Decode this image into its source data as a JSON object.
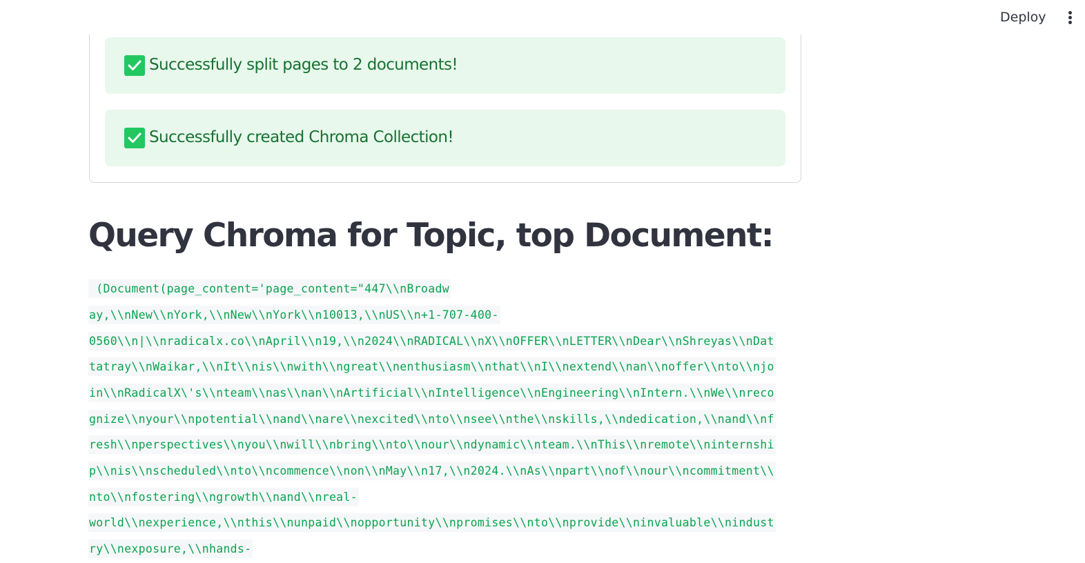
{
  "header": {
    "deploy_label": "Deploy",
    "menu_icon": "vertical-ellipsis-icon"
  },
  "alerts": [
    {
      "icon": "check-box-icon",
      "text": "Successfully split pages to 2 documents!"
    },
    {
      "icon": "check-box-icon",
      "text": "Successfully created Chroma Collection!"
    }
  ],
  "main": {
    "title": "Query Chroma for Topic, top Document:",
    "code_lines": [
      " (Document(page_content='page_content=\"447\\\\nBroadw",
      "ay,\\\\nNew\\\\nYork,\\\\nNew\\\\nYork\\\\n10013,\\\\nUS\\\\n+1-707-400-",
      "0560\\\\n|\\\\nradicalx.co\\\\nApril\\\\n19,\\\\n2024\\\\nRADICAL\\\\nX\\\\nOFFER\\\\nLETTER\\\\nDear\\\\nShreyas\\\\nDat",
      "tatray\\\\nWaikar,\\\\nIt\\\\nis\\\\nwith\\\\ngreat\\\\nenthusiasm\\\\nthat\\\\nI\\\\nextend\\\\nan\\\\noffer\\\\nto\\\\njo",
      "in\\\\nRadicalX\\'s\\\\nteam\\\\nas\\\\nan\\\\nArtificial\\\\nIntelligence\\\\nEngineering\\\\nIntern.\\\\nWe\\\\nreco",
      "gnize\\\\nyour\\\\npotential\\\\nand\\\\nare\\\\nexcited\\\\nto\\\\nsee\\\\nthe\\\\nskills,\\\\ndedication,\\\\nand\\\\nf",
      "resh\\\\nperspectives\\\\nyou\\\\nwill\\\\nbring\\\\nto\\\\nour\\\\ndynamic\\\\nteam.\\\\nThis\\\\nremote\\\\ninternshi",
      "p\\\\nis\\\\nscheduled\\\\nto\\\\ncommence\\\\non\\\\nMay\\\\n17,\\\\n2024.\\\\nAs\\\\npart\\\\nof\\\\nour\\\\ncommitment\\\\",
      "nto\\\\nfostering\\\\ngrowth\\\\nand\\\\nreal-",
      "world\\\\nexperience,\\\\nthis\\\\nunpaid\\\\nopportunity\\\\npromises\\\\nto\\\\nprovide\\\\ninvaluable\\\\nindust",
      "ry\\\\nexposure,\\\\nhands-"
    ]
  },
  "colors": {
    "alert_background": "#e8f8ec",
    "alert_text": "#177233",
    "check_icon": "#23c761",
    "code_text": "#09a44f",
    "code_background": "#f6f7f9",
    "title_text": "#31333f"
  }
}
